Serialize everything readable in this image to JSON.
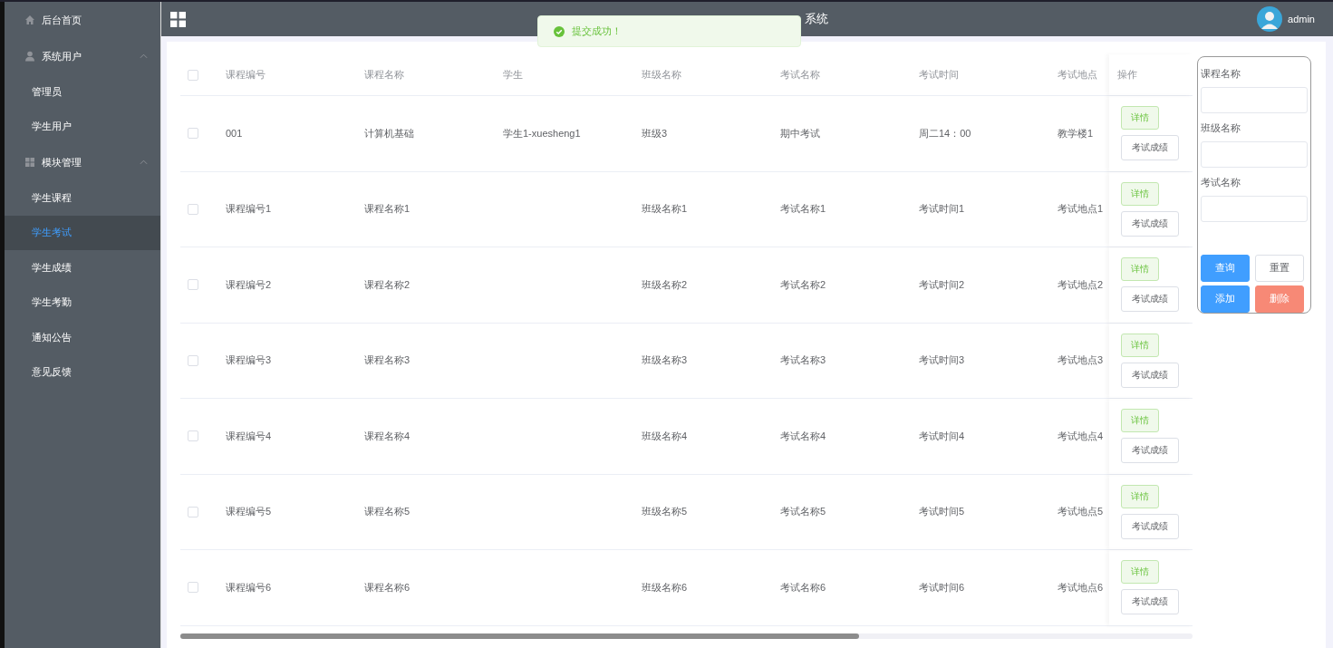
{
  "sidebar": {
    "items": [
      {
        "kind": "top",
        "label": "后台首页",
        "selected": false
      },
      {
        "kind": "group",
        "label": "系统用户",
        "expanded": true,
        "children": [
          {
            "label": "管理员",
            "selected": false
          },
          {
            "label": "学生用户",
            "selected": false
          }
        ]
      },
      {
        "kind": "group",
        "label": "模块管理",
        "expanded": true,
        "children": [
          {
            "label": "学生课程",
            "selected": false
          },
          {
            "label": "学生考试",
            "selected": true
          },
          {
            "label": "学生成绩",
            "selected": false
          },
          {
            "label": "学生考勤",
            "selected": false
          },
          {
            "label": "通知公告",
            "selected": false
          },
          {
            "label": "意见反馈",
            "selected": false
          }
        ]
      }
    ]
  },
  "header": {
    "title": "系统",
    "user": "admin"
  },
  "toast": {
    "message": "提交成功！"
  },
  "table": {
    "all_checked": false,
    "columns": [
      "课程编号",
      "课程名称",
      "学生",
      "班级名称",
      "考试名称",
      "考试时间",
      "考试地点",
      "操作"
    ],
    "rows": [
      {
        "checked": false,
        "cells": [
          "001",
          "计算机基础",
          "学生1-xuesheng1",
          "班级3",
          "期中考试",
          "周二14：00",
          "教学楼1"
        ],
        "actions": [
          "详情",
          "考试成绩"
        ]
      },
      {
        "checked": false,
        "cells": [
          "课程编号1",
          "课程名称1",
          "",
          "班级名称1",
          "考试名称1",
          "考试时间1",
          "考试地点1"
        ],
        "actions": [
          "详情",
          "考试成绩"
        ]
      },
      {
        "checked": false,
        "cells": [
          "课程编号2",
          "课程名称2",
          "",
          "班级名称2",
          "考试名称2",
          "考试时间2",
          "考试地点2"
        ],
        "actions": [
          "详情",
          "考试成绩"
        ]
      },
      {
        "checked": false,
        "cells": [
          "课程编号3",
          "课程名称3",
          "",
          "班级名称3",
          "考试名称3",
          "考试时间3",
          "考试地点3"
        ],
        "actions": [
          "详情",
          "考试成绩"
        ]
      },
      {
        "checked": false,
        "cells": [
          "课程编号4",
          "课程名称4",
          "",
          "班级名称4",
          "考试名称4",
          "考试时间4",
          "考试地点4"
        ],
        "actions": [
          "详情",
          "考试成绩"
        ]
      },
      {
        "checked": false,
        "cells": [
          "课程编号5",
          "课程名称5",
          "",
          "班级名称5",
          "考试名称5",
          "考试时间5",
          "考试地点5"
        ],
        "actions": [
          "详情",
          "考试成绩"
        ]
      },
      {
        "checked": false,
        "cells": [
          "课程编号6",
          "课程名称6",
          "",
          "班级名称6",
          "考试名称6",
          "考试时间6",
          "考试地点6"
        ],
        "actions": [
          "详情",
          "考试成绩"
        ]
      }
    ]
  },
  "search": {
    "fields": [
      {
        "label": "课程名称"
      },
      {
        "label": "班级名称"
      },
      {
        "label": "考试名称"
      }
    ],
    "buttons": [
      {
        "label": "查询",
        "kind": "primary"
      },
      {
        "label": "重置",
        "kind": "default"
      },
      {
        "label": "添加",
        "kind": "primary"
      },
      {
        "label": "删除",
        "kind": "danger"
      }
    ]
  }
}
